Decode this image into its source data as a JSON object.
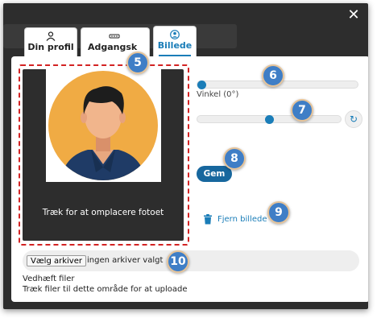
{
  "close_icon": "close-icon",
  "tabs": [
    {
      "label": "Din profil",
      "icon": "user-icon",
      "active": false
    },
    {
      "label": "Adgangsk",
      "icon": "key-icon",
      "active": false
    },
    {
      "label": "Billede",
      "icon": "user-circle-icon",
      "active": true
    }
  ],
  "photo": {
    "caption": "Træk for at omplacere fotoet",
    "icon": "avatar-placeholder"
  },
  "angle_slider": {
    "label": "Vinkel (0°)",
    "value_fraction": 0.0
  },
  "zoom_slider": {
    "value_fraction": 0.5,
    "refresh_icon": "refresh-icon"
  },
  "save_label": "Gem",
  "remove_label": "Fjern billede",
  "remove_icon": "trash-icon",
  "file": {
    "button_label": "Vælg arkiver",
    "status": "ingen arkiver valgt"
  },
  "attach_label": "Vedhæft filer",
  "drag_hint": "Træk filer til dette område for at uploade",
  "badges": [
    "5",
    "6",
    "7",
    "8",
    "9",
    "10"
  ],
  "colors": {
    "accent": "#1a7db8",
    "badge": "#3f7ec6",
    "highlight": "#d32323"
  }
}
